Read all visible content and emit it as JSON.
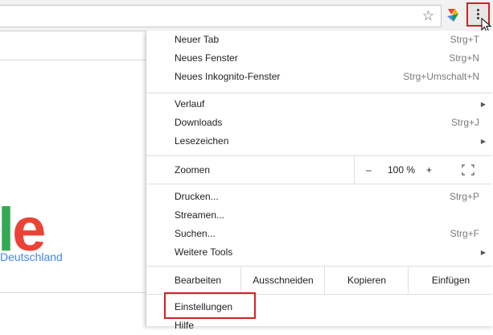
{
  "toolbar": {
    "bookmark_icon": "star-icon",
    "extension_icon": "extension-icon",
    "menu_icon": "three-dots-vertical-icon",
    "accent_color": "#d61f26"
  },
  "page": {
    "logo_fragment_l": "l",
    "logo_fragment_e": "e",
    "region_text": "Deutschland"
  },
  "menu": {
    "new_tab": {
      "label": "Neuer Tab",
      "shortcut": "Strg+T"
    },
    "new_window": {
      "label": "Neues Fenster",
      "shortcut": "Strg+N"
    },
    "new_incognito": {
      "label": "Neues Inkognito-Fenster",
      "shortcut": "Strg+Umschalt+N"
    },
    "history": {
      "label": "Verlauf"
    },
    "downloads": {
      "label": "Downloads",
      "shortcut": "Strg+J"
    },
    "bookmarks": {
      "label": "Lesezeichen"
    },
    "zoom": {
      "label": "Zoomen",
      "minus": "–",
      "value": "100 %",
      "plus": "+"
    },
    "print": {
      "label": "Drucken...",
      "shortcut": "Strg+P"
    },
    "cast": {
      "label": "Streamen..."
    },
    "find": {
      "label": "Suchen...",
      "shortcut": "Strg+F"
    },
    "more_tools": {
      "label": "Weitere Tools"
    },
    "edit": {
      "label": "Bearbeiten",
      "cut": "Ausschneiden",
      "copy": "Kopieren",
      "paste": "Einfügen"
    },
    "settings": {
      "label": "Einstellungen"
    },
    "help": {
      "label": "Hilfe"
    }
  }
}
